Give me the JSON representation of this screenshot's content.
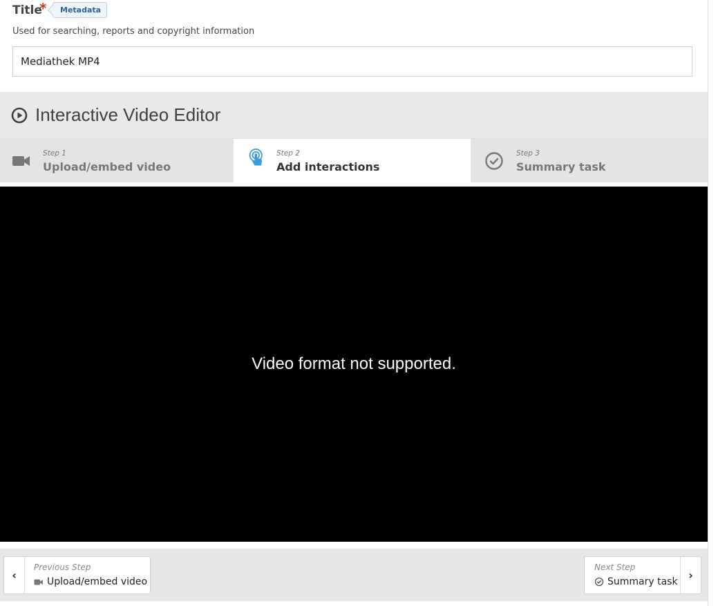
{
  "title_field": {
    "label": "Title",
    "required_mark": "*",
    "tag": "Metadata",
    "description": "Used for searching, reports and copyright information",
    "value": "Mediathek MP4"
  },
  "editor": {
    "title": "Interactive Video Editor",
    "icon": "play-circle-icon"
  },
  "tabs": [
    {
      "step": "Step 1",
      "label": "Upload/embed video",
      "icon": "video-camera-icon",
      "active": false
    },
    {
      "step": "Step 2",
      "label": "Add interactions",
      "icon": "touch-hand-icon",
      "active": true
    },
    {
      "step": "Step 3",
      "label": "Summary task",
      "icon": "check-circle-icon",
      "active": false
    }
  ],
  "video": {
    "message": "Video format not supported."
  },
  "footer": {
    "prev": {
      "small": "Previous Step",
      "label": "Upload/embed video",
      "arrow": "‹"
    },
    "next": {
      "small": "Next Step",
      "label": "Summary task",
      "arrow": "›"
    }
  },
  "colors": {
    "accent": "#3d9be0",
    "required": "#c0392b",
    "video_bg": "#000000"
  }
}
